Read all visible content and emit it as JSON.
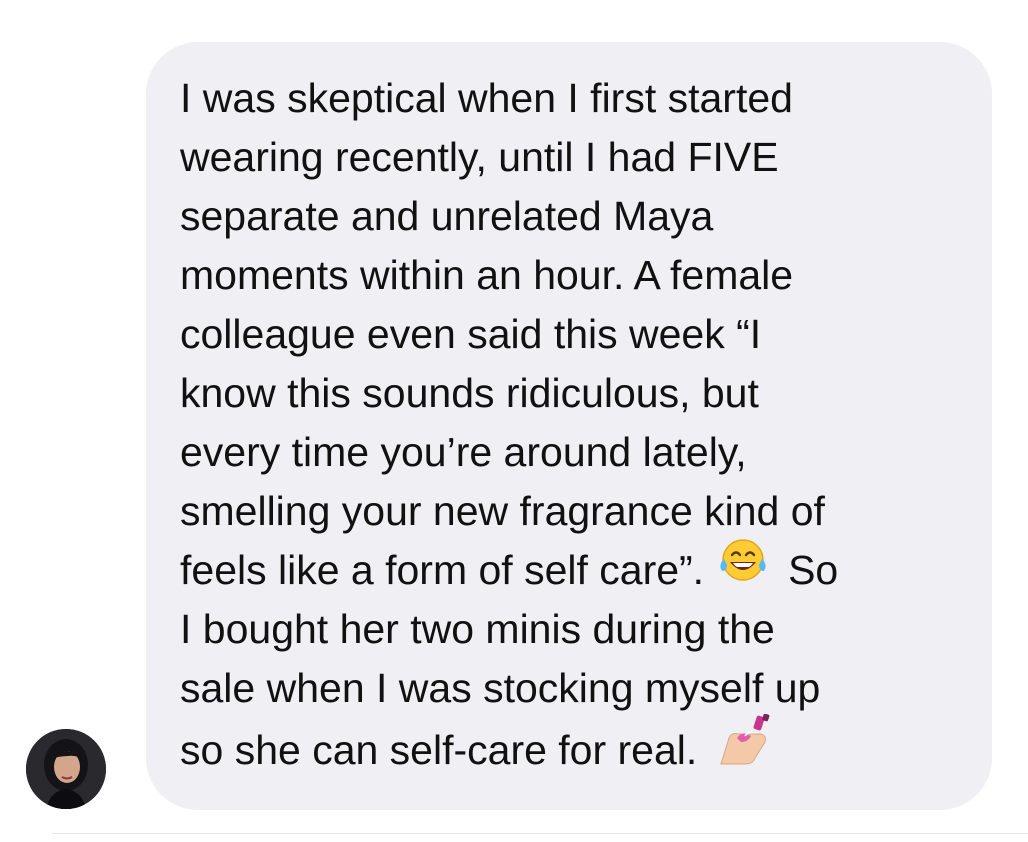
{
  "message": {
    "lines": [
      "I was skeptical when I first started",
      "wearing recently, until I had FIVE",
      "separate and unrelated Maya",
      "moments within an hour. A female",
      "colleague even said this week “I",
      "know this sounds ridiculous, but",
      "every time you’re around lately,",
      "smelling your new fragrance kind of",
      "feels like a form of self care”.",
      "So",
      "I bought her two minis during the",
      "sale when I was stocking myself up",
      "so she can self-care for real."
    ],
    "emojis": [
      "tears-of-joy-emoji",
      "nail-polish-emoji"
    ]
  },
  "sender": {
    "avatar": "profile-photo"
  },
  "colors": {
    "bubble": "#efeff4",
    "text": "#111111",
    "background": "#ffffff"
  }
}
